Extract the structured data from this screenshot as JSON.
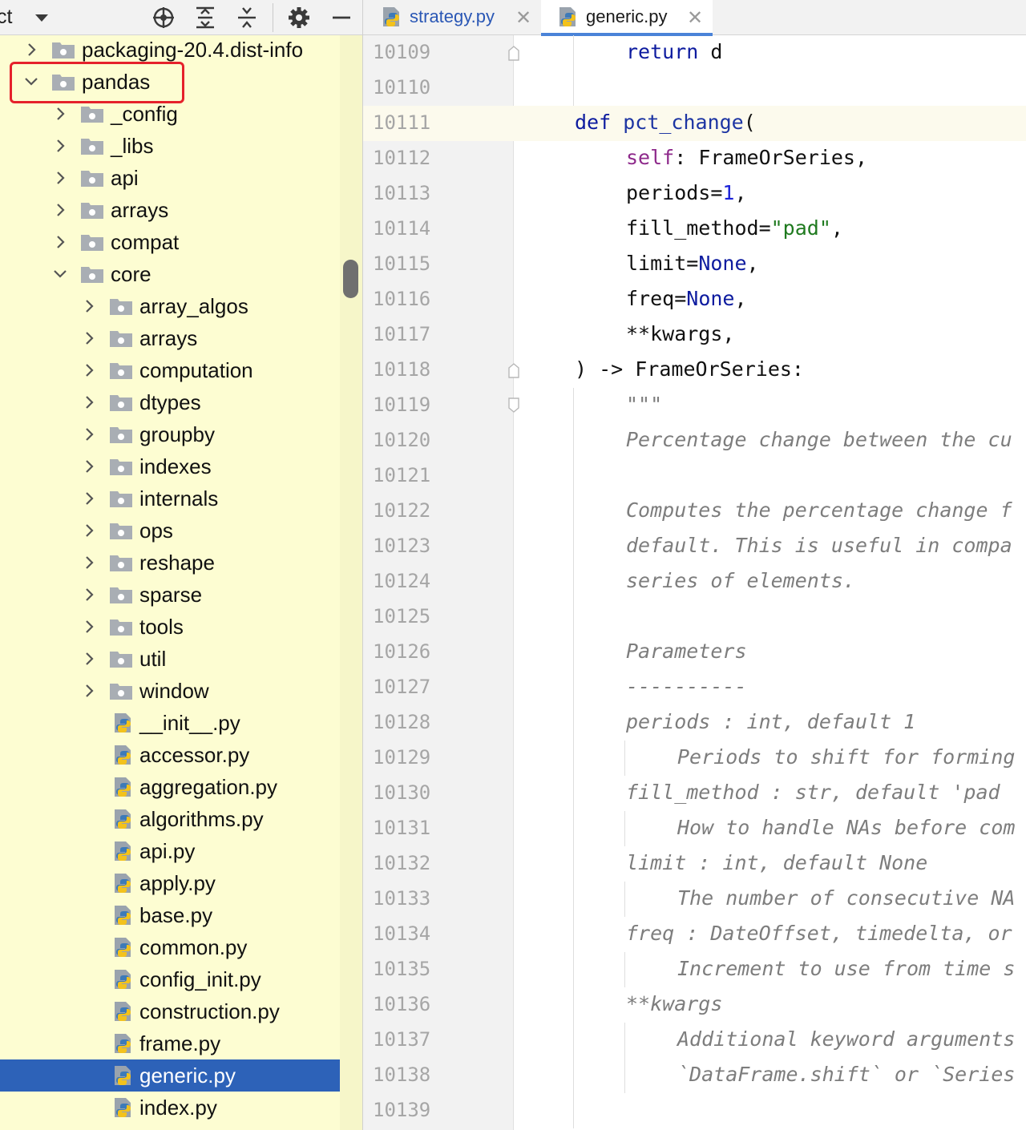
{
  "project_panel": {
    "title": "ct",
    "toolbar_icons": [
      "crosshair-icon",
      "expand-all-icon",
      "collapse-all-icon",
      "gear-icon",
      "minimize-icon"
    ],
    "tree": [
      {
        "label": "packaging-20.4.dist-info",
        "type": "folder",
        "expanded": false,
        "level": 1
      },
      {
        "label": "pandas",
        "type": "folder",
        "expanded": true,
        "level": 1
      },
      {
        "label": "_config",
        "type": "folder",
        "expanded": false,
        "level": 2
      },
      {
        "label": "_libs",
        "type": "folder",
        "expanded": false,
        "level": 2
      },
      {
        "label": "api",
        "type": "folder",
        "expanded": false,
        "level": 2
      },
      {
        "label": "arrays",
        "type": "folder",
        "expanded": false,
        "level": 2
      },
      {
        "label": "compat",
        "type": "folder",
        "expanded": false,
        "level": 2
      },
      {
        "label": "core",
        "type": "folder",
        "expanded": true,
        "level": 2
      },
      {
        "label": "array_algos",
        "type": "folder",
        "expanded": false,
        "level": 3
      },
      {
        "label": "arrays",
        "type": "folder",
        "expanded": false,
        "level": 3
      },
      {
        "label": "computation",
        "type": "folder",
        "expanded": false,
        "level": 3
      },
      {
        "label": "dtypes",
        "type": "folder",
        "expanded": false,
        "level": 3
      },
      {
        "label": "groupby",
        "type": "folder",
        "expanded": false,
        "level": 3
      },
      {
        "label": "indexes",
        "type": "folder",
        "expanded": false,
        "level": 3
      },
      {
        "label": "internals",
        "type": "folder",
        "expanded": false,
        "level": 3
      },
      {
        "label": "ops",
        "type": "folder",
        "expanded": false,
        "level": 3
      },
      {
        "label": "reshape",
        "type": "folder",
        "expanded": false,
        "level": 3
      },
      {
        "label": "sparse",
        "type": "folder",
        "expanded": false,
        "level": 3
      },
      {
        "label": "tools",
        "type": "folder",
        "expanded": false,
        "level": 3
      },
      {
        "label": "util",
        "type": "folder",
        "expanded": false,
        "level": 3
      },
      {
        "label": "window",
        "type": "folder",
        "expanded": false,
        "level": 3
      },
      {
        "label": "__init__.py",
        "type": "file",
        "level": 3
      },
      {
        "label": "accessor.py",
        "type": "file",
        "level": 3
      },
      {
        "label": "aggregation.py",
        "type": "file",
        "level": 3
      },
      {
        "label": "algorithms.py",
        "type": "file",
        "level": 3
      },
      {
        "label": "api.py",
        "type": "file",
        "level": 3
      },
      {
        "label": "apply.py",
        "type": "file",
        "level": 3
      },
      {
        "label": "base.py",
        "type": "file",
        "level": 3
      },
      {
        "label": "common.py",
        "type": "file",
        "level": 3
      },
      {
        "label": "config_init.py",
        "type": "file",
        "level": 3
      },
      {
        "label": "construction.py",
        "type": "file",
        "level": 3
      },
      {
        "label": "frame.py",
        "type": "file",
        "level": 3
      },
      {
        "label": "generic.py",
        "type": "file",
        "level": 3,
        "selected": true
      },
      {
        "label": "index.py",
        "type": "file",
        "level": 3
      }
    ]
  },
  "editor": {
    "tabs": [
      {
        "label": "strategy.py",
        "active": false
      },
      {
        "label": "generic.py",
        "active": true
      }
    ],
    "lines": [
      {
        "num": "10109",
        "indent": 2,
        "tokens": [
          {
            "t": "return",
            "c": "kw"
          },
          {
            "t": " d",
            "c": ""
          }
        ]
      },
      {
        "num": "10110",
        "indent": 0,
        "tokens": []
      },
      {
        "num": "10111",
        "indent": 1,
        "current": true,
        "tokens": [
          {
            "t": "def",
            "c": "kw"
          },
          {
            "t": " ",
            "c": ""
          },
          {
            "t": "pct_change",
            "c": "fn"
          },
          {
            "t": "(",
            "c": ""
          }
        ]
      },
      {
        "num": "10112",
        "indent": 2,
        "tokens": [
          {
            "t": "self",
            "c": "self"
          },
          {
            "t": ": FrameOrSeries,",
            "c": ""
          }
        ]
      },
      {
        "num": "10113",
        "indent": 2,
        "tokens": [
          {
            "t": "periods=",
            "c": ""
          },
          {
            "t": "1",
            "c": "num"
          },
          {
            "t": ",",
            "c": ""
          }
        ]
      },
      {
        "num": "10114",
        "indent": 2,
        "tokens": [
          {
            "t": "fill_method=",
            "c": ""
          },
          {
            "t": "\"pad\"",
            "c": "str"
          },
          {
            "t": ",",
            "c": ""
          }
        ]
      },
      {
        "num": "10115",
        "indent": 2,
        "tokens": [
          {
            "t": "limit=",
            "c": ""
          },
          {
            "t": "None",
            "c": "kw"
          },
          {
            "t": ",",
            "c": ""
          }
        ]
      },
      {
        "num": "10116",
        "indent": 2,
        "tokens": [
          {
            "t": "freq=",
            "c": ""
          },
          {
            "t": "None",
            "c": "kw"
          },
          {
            "t": ",",
            "c": ""
          }
        ]
      },
      {
        "num": "10117",
        "indent": 2,
        "tokens": [
          {
            "t": "**kwargs,",
            "c": ""
          }
        ]
      },
      {
        "num": "10118",
        "indent": 1,
        "tokens": [
          {
            "t": ") -> FrameOrSeries:",
            "c": ""
          }
        ]
      },
      {
        "num": "10119",
        "indent": 2,
        "tokens": [
          {
            "t": "\"\"\"",
            "c": "doc"
          }
        ]
      },
      {
        "num": "10120",
        "indent": 2,
        "tokens": [
          {
            "t": "Percentage change between the cu",
            "c": "doc"
          }
        ]
      },
      {
        "num": "10121",
        "indent": 0,
        "tokens": []
      },
      {
        "num": "10122",
        "indent": 2,
        "tokens": [
          {
            "t": "Computes the percentage change f",
            "c": "doc"
          }
        ]
      },
      {
        "num": "10123",
        "indent": 2,
        "tokens": [
          {
            "t": "default. This is useful in compa",
            "c": "doc"
          }
        ]
      },
      {
        "num": "10124",
        "indent": 2,
        "tokens": [
          {
            "t": "series of elements.",
            "c": "doc"
          }
        ]
      },
      {
        "num": "10125",
        "indent": 0,
        "tokens": []
      },
      {
        "num": "10126",
        "indent": 2,
        "tokens": [
          {
            "t": "Parameters",
            "c": "doc"
          }
        ]
      },
      {
        "num": "10127",
        "indent": 2,
        "tokens": [
          {
            "t": "----------",
            "c": "doc"
          }
        ]
      },
      {
        "num": "10128",
        "indent": 2,
        "tokens": [
          {
            "t": "periods : int, default 1",
            "c": "doc"
          }
        ]
      },
      {
        "num": "10129",
        "indent": 3,
        "tokens": [
          {
            "t": "Periods to shift for forming",
            "c": "doc"
          }
        ]
      },
      {
        "num": "10130",
        "indent": 2,
        "tokens": [
          {
            "t": "fill_method : str, default 'pad",
            "c": "doc"
          }
        ]
      },
      {
        "num": "10131",
        "indent": 3,
        "tokens": [
          {
            "t": "How to handle NAs before com",
            "c": "doc"
          }
        ]
      },
      {
        "num": "10132",
        "indent": 2,
        "tokens": [
          {
            "t": "limit : int, default None",
            "c": "doc"
          }
        ]
      },
      {
        "num": "10133",
        "indent": 3,
        "tokens": [
          {
            "t": "The number of consecutive NA",
            "c": "doc"
          }
        ]
      },
      {
        "num": "10134",
        "indent": 2,
        "tokens": [
          {
            "t": "freq : DateOffset, timedelta, or",
            "c": "doc"
          }
        ]
      },
      {
        "num": "10135",
        "indent": 3,
        "tokens": [
          {
            "t": "Increment to use from time s",
            "c": "doc"
          }
        ]
      },
      {
        "num": "10136",
        "indent": 2,
        "tokens": [
          {
            "t": "**kwargs",
            "c": "doc"
          }
        ]
      },
      {
        "num": "10137",
        "indent": 3,
        "tokens": [
          {
            "t": "Additional keyword arguments",
            "c": "doc"
          }
        ]
      },
      {
        "num": "10138",
        "indent": 3,
        "tokens": [
          {
            "t": "`DataFrame.shift` or `Series",
            "c": "doc"
          }
        ]
      },
      {
        "num": "10139",
        "indent": 0,
        "tokens": []
      }
    ]
  }
}
